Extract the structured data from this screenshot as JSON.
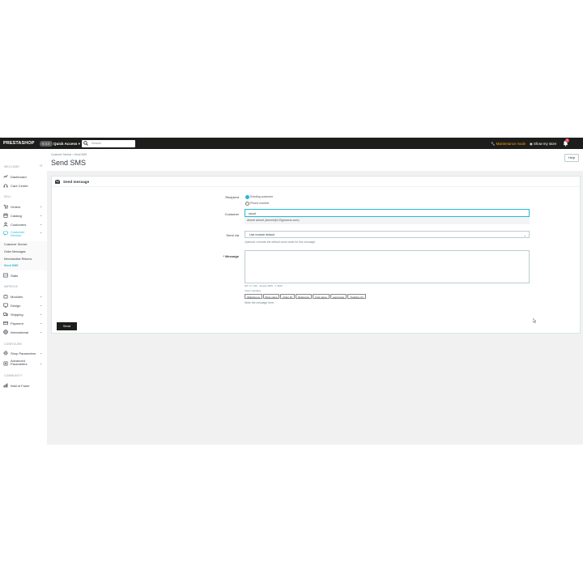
{
  "topbar": {
    "logo": "PRESTASHOP",
    "version": "9.0.0",
    "quick_access": "Quick Access ▾",
    "search_placeholder": "Search",
    "maintenance": "Maintenance mode",
    "show_store": "Show my store",
    "notifications_count": "2"
  },
  "sidebar": {
    "collapse": "‹‹",
    "sections": {
      "welcome": "WELCOME",
      "sell": "SELL",
      "improve": "IMPROVE",
      "configure": "CONFIGURE",
      "community": "COMMUNITY"
    },
    "items": [
      {
        "label": "Dashboard",
        "icon": "trending-up-icon"
      },
      {
        "label": "Care Center",
        "icon": "support-icon"
      },
      {
        "label": "Orders",
        "icon": "cart-icon"
      },
      {
        "label": "Catalog",
        "icon": "store-icon"
      },
      {
        "label": "Customers",
        "icon": "user-icon"
      },
      {
        "label": "Customer Service",
        "icon": "chat-icon"
      },
      {
        "label": "Stats",
        "icon": "chart-icon"
      },
      {
        "label": "Modules",
        "icon": "puzzle-icon"
      },
      {
        "label": "Design",
        "icon": "desktop-icon"
      },
      {
        "label": "Shipping",
        "icon": "truck-icon"
      },
      {
        "label": "Payment",
        "icon": "card-icon"
      },
      {
        "label": "International",
        "icon": "globe-icon"
      },
      {
        "label": "Shop Parameters",
        "icon": "settings-icon"
      },
      {
        "label": "Advanced Parameters",
        "icon": "gear-icon"
      },
      {
        "label": "Wall of Fame",
        "icon": "bar-chart-icon"
      }
    ],
    "customer_service_sub": [
      "Customer Service",
      "Order Messages",
      "Merchandise Returns",
      "Send SMS"
    ]
  },
  "header": {
    "breadcrumb": [
      "Customer Service",
      "Send SMS"
    ],
    "title": "Send SMS",
    "help": "Help"
  },
  "form": {
    "card_title": "Send message",
    "recipient_label": "Recipient",
    "recipient_options": [
      "Existing customer",
      "Phone number"
    ],
    "customer_label": "Customer",
    "customer_value": "raoul",
    "customer_suggestion": "ahmet ahmet (ahmet@123gmarcio.com)",
    "send_via_label": "Send via",
    "send_via_value": "Use module default",
    "send_via_hint": "Optional: override the default send mode for this message.",
    "message_label": "* Message",
    "counter": "0/0 / 0 / 160 - Simple SMS - 1 SMS",
    "insert_variables": "Insert variables",
    "variables": [
      "Shipping no",
      "Shop name",
      "Order ID",
      "Reference",
      "First name",
      "Last name",
      "Tracking Url"
    ],
    "message_hint": "Write the message here.",
    "send_button": "Send"
  }
}
